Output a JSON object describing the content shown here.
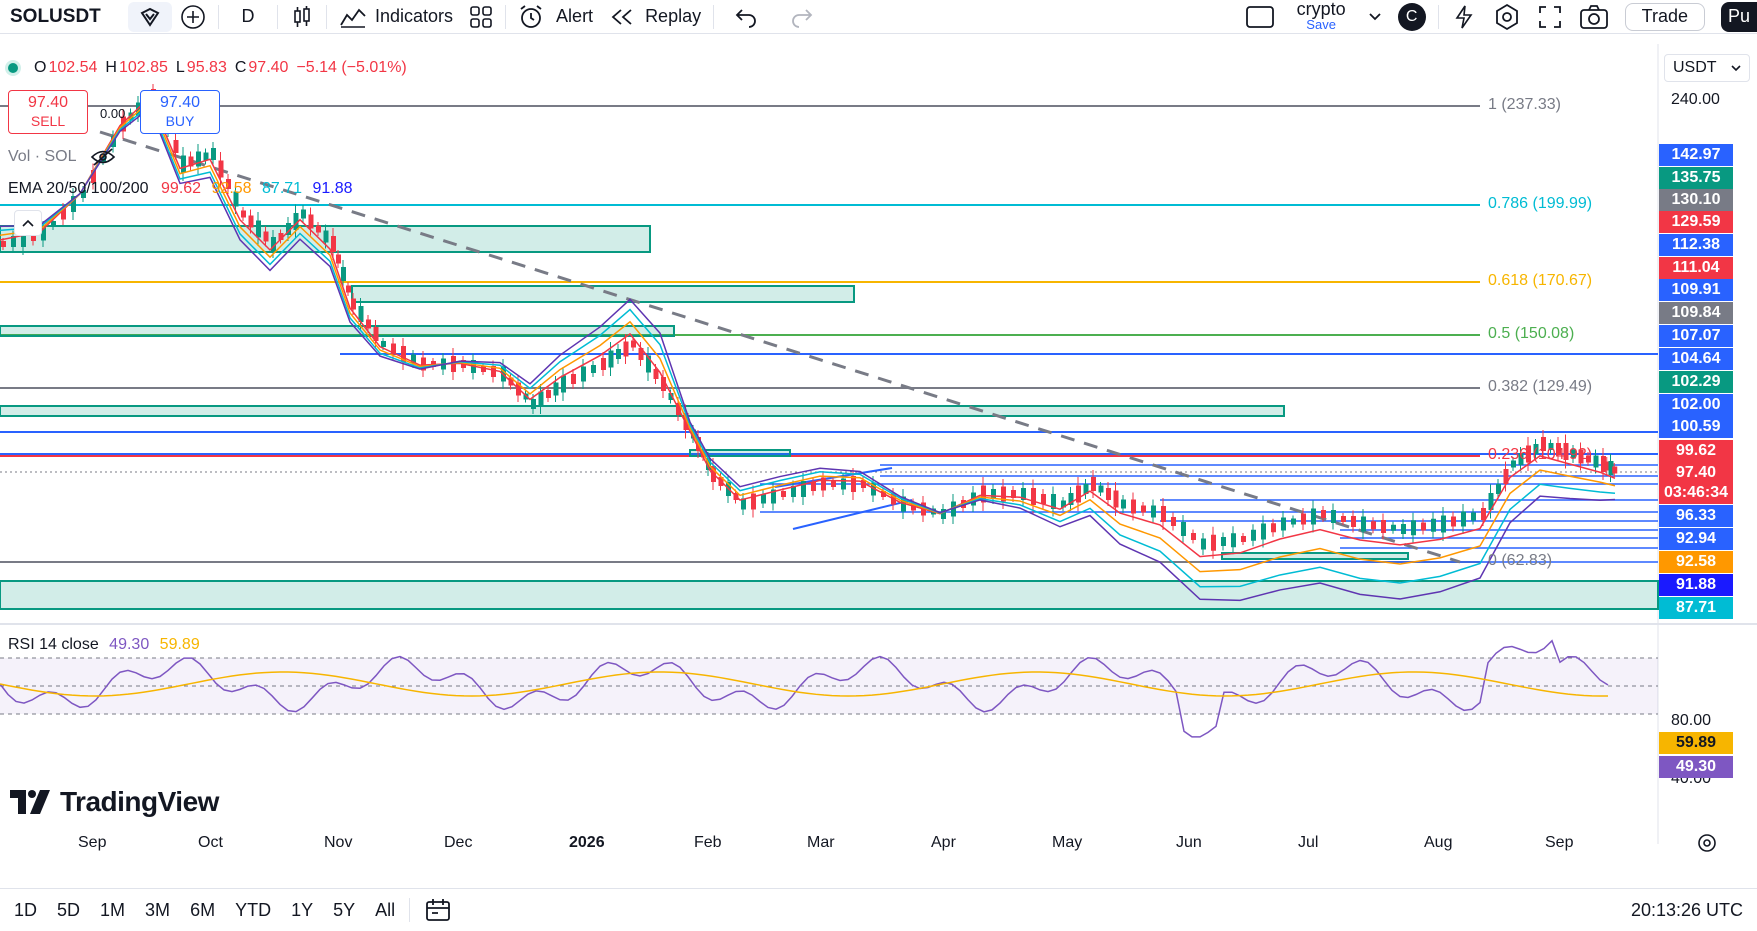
{
  "toolbar": {
    "symbol": "SOLUSDT",
    "interval": "D",
    "indicators_label": "Indicators",
    "alert_label": "Alert",
    "replay_label": "Replay",
    "layout_name": "crypto",
    "layout_save": "Save",
    "avatar_letter": "C",
    "trade_label": "Trade",
    "publish_label": "Pu"
  },
  "ohlc": {
    "o_label": "O",
    "o": "102.54",
    "h_label": "H",
    "h": "102.85",
    "l_label": "L",
    "l": "95.83",
    "c_label": "C",
    "c": "97.40",
    "change": "−5.14 (−5.01%)"
  },
  "trade_buttons": {
    "sell_price": "97.40",
    "sell_label": "SELL",
    "spread": "0.00",
    "buy_price": "97.40",
    "buy_label": "BUY"
  },
  "volume_label": "Vol · SOL",
  "ema": {
    "label": "EMA 20/50/100/200",
    "v20": "99.62",
    "v50": "92.58",
    "v100": "87.71",
    "v200": "91.88"
  },
  "currency": "USDT",
  "fib_levels": [
    {
      "label": "1 (237.33)",
      "color": "#787b86"
    },
    {
      "label": "0.786 (199.99)",
      "color": "#00bcd4"
    },
    {
      "label": "0.618 (170.67)",
      "color": "#f7b500"
    },
    {
      "label": "0.5 (150.08)",
      "color": "#4caf50"
    },
    {
      "label": "0.382 (129.49)",
      "color": "#787b86"
    },
    {
      "label": "0.236 (104.92)",
      "color": "#f23645"
    },
    {
      "label": "0 (62.83)",
      "color": "#787b86"
    }
  ],
  "price_axis_top": "240.00",
  "price_tags": [
    {
      "v": "142.97",
      "bg": "#2962ff"
    },
    {
      "v": "135.75",
      "bg": "#089981"
    },
    {
      "v": "130.10",
      "bg": "#787b86"
    },
    {
      "v": "129.59",
      "bg": "#f23645"
    },
    {
      "v": "112.38",
      "bg": "#2962ff"
    },
    {
      "v": "111.04",
      "bg": "#f23645"
    },
    {
      "v": "109.91",
      "bg": "#2962ff"
    },
    {
      "v": "109.84",
      "bg": "#787b86"
    },
    {
      "v": "107.07",
      "bg": "#2962ff"
    },
    {
      "v": "104.64",
      "bg": "#2962ff"
    },
    {
      "v": "102.29",
      "bg": "#089981"
    },
    {
      "v": "102.00",
      "bg": "#2962ff"
    },
    {
      "v": "100.59",
      "bg": "#2962ff"
    },
    {
      "v": "99.62",
      "bg": "#f23645"
    },
    {
      "v": "97.40",
      "bg": "#f23645"
    },
    {
      "v": "03:46:34",
      "bg": "#f23645"
    },
    {
      "v": "96.33",
      "bg": "#2962ff"
    },
    {
      "v": "92.94",
      "bg": "#2962ff"
    },
    {
      "v": "92.58",
      "bg": "#ff9800"
    },
    {
      "v": "91.88",
      "bg": "#1a1aff"
    },
    {
      "v": "87.71",
      "bg": "#00bcd4"
    }
  ],
  "rsi": {
    "label": "RSI 14 close",
    "value": "49.30",
    "ma": "59.89",
    "axis_top": "80.00",
    "axis_mid": "40.00",
    "tag_ma": "59.89",
    "tag_val": "49.30"
  },
  "watermark": "TradingView",
  "time_axis": [
    "Sep",
    "Oct",
    "Nov",
    "Dec",
    "2026",
    "Feb",
    "Mar",
    "Apr",
    "May",
    "Jun",
    "Jul",
    "Aug",
    "Sep"
  ],
  "ranges": [
    "1D",
    "5D",
    "1M",
    "3M",
    "6M",
    "YTD",
    "1Y",
    "5Y",
    "All"
  ],
  "clock": "20:13:26 UTC",
  "colors": {
    "up": "#089981",
    "down": "#f23645",
    "accent": "#2962ff"
  },
  "icons": [
    "favorite-icon",
    "add-symbol-icon",
    "candles-icon",
    "indicators-icon",
    "templates-icon",
    "alert-icon",
    "replay-icon",
    "undo-icon",
    "redo-icon",
    "layout-icon",
    "chevron-down-icon",
    "quick-search-icon",
    "settings-icon",
    "fullscreen-icon",
    "camera-icon",
    "calendar-icon",
    "eye-off-icon",
    "collapse-icon",
    "time-axis-settings-icon"
  ]
}
